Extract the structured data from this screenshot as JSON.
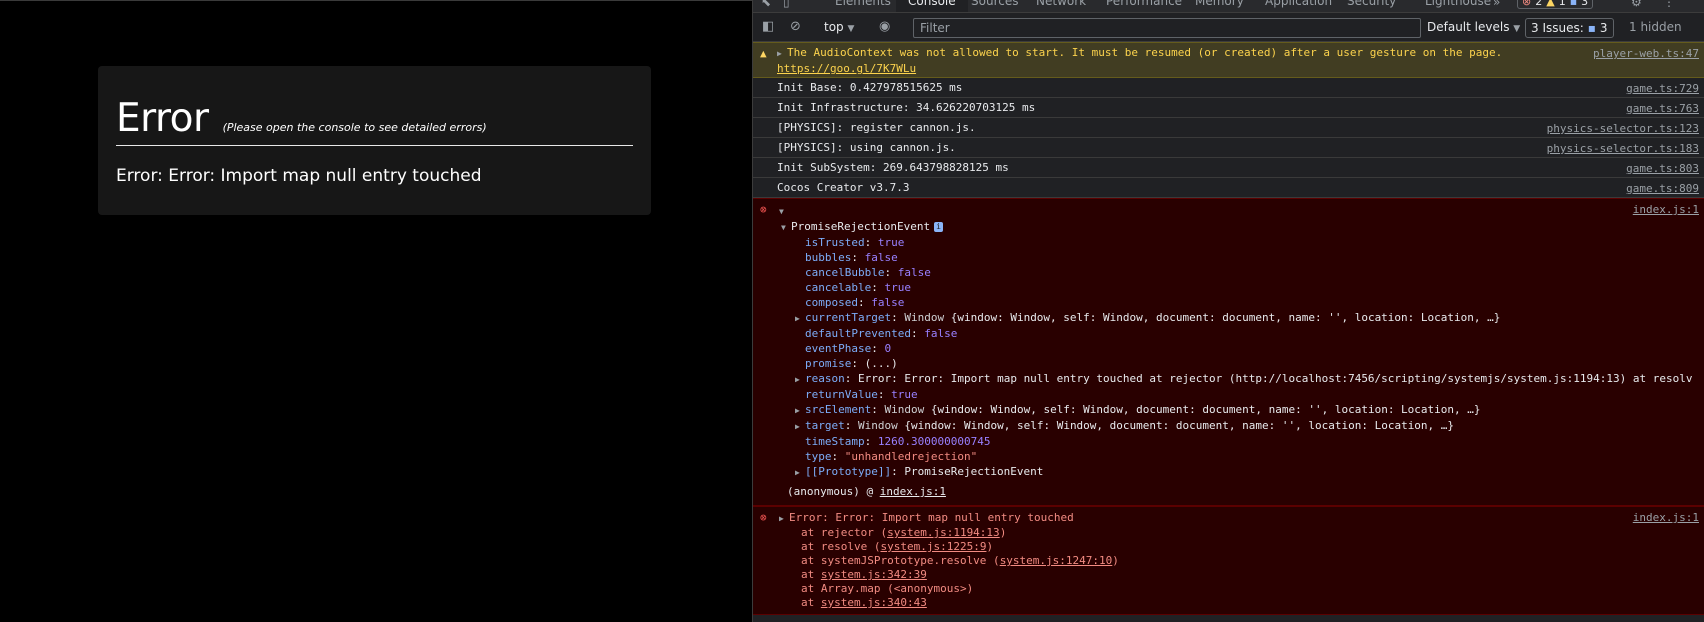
{
  "game": {
    "error_title": "Error",
    "error_hint": "(Please open the console to see detailed errors)",
    "error_message": "Error: Error: Import map null entry touched"
  },
  "devtools": {
    "tabs": [
      "Elements",
      "Console",
      "Sources",
      "Network",
      "Performance",
      "Memory",
      "Application",
      "Security",
      "Lighthouse"
    ],
    "counters": {
      "errors": "2",
      "warnings": "1",
      "info": "3"
    },
    "toolbar": {
      "context": "top",
      "filter_placeholder": "Filter",
      "levels": "Default levels",
      "issues_label": "3 Issues:",
      "issues_count": "3",
      "hidden": "1 hidden"
    },
    "colors": {
      "error_bg": "#290000",
      "warn_bg": "#413d22",
      "accent": "#8ab4f8"
    }
  },
  "console": {
    "warning": {
      "text": "The AudioContext was not allowed to start. It must be resumed (or created) after a user gesture on the page.",
      "link": "https://goo.gl/7K7WLu",
      "source": "player-web.ts:47"
    },
    "logs": [
      {
        "text": "Init Base: 0.427978515625 ms",
        "source": "game.ts:729"
      },
      {
        "text": "Init Infrastructure: 34.626220703125 ms",
        "source": "game.ts:763"
      },
      {
        "text": "[PHYSICS]: register cannon.js.",
        "source": "physics-selector.ts:123"
      },
      {
        "text": "[PHYSICS]: using cannon.js.",
        "source": "physics-selector.ts:183"
      },
      {
        "text": "Init SubSystem: 269.643798828125 ms",
        "source": "game.ts:803"
      },
      {
        "text": "Cocos Creator v3.7.3",
        "source": "game.ts:809"
      }
    ],
    "rejection": {
      "source": "index.js:1",
      "event_name": "PromiseRejectionEvent",
      "badge": "i",
      "props": {
        "isTrusted": "true",
        "bubbles": "false",
        "cancelBubble": "false",
        "cancelable": "true",
        "composed": "false",
        "currentTarget_type": "Window",
        "currentTarget_preview": "{window: Window, self: Window, document: document, name: '', location: Location, …}",
        "defaultPrevented": "false",
        "eventPhase": "0",
        "promise": "(...)",
        "reason": "Error: Error: Import map null entry touched at rejector (http://localhost:7456/scripting/systemjs/system.js:1194:13) at resolv",
        "returnValue": "true",
        "srcElement_type": "Window",
        "srcElement_preview": "{window: Window, self: Window, document: document, name: '', location: Location, …}",
        "target_type": "Window",
        "target_preview": "{window: Window, self: Window, document: document, name: '', location: Location, …}",
        "timeStamp": "1260.300000000745",
        "type": "\"unhandledrejection\"",
        "prototype": "PromiseRejectionEvent"
      },
      "anonymous_label": "(anonymous) @",
      "anonymous_link": "index.js:1"
    },
    "error": {
      "message": "Error: Error: Import map null entry touched",
      "source": "index.js:1",
      "stack": [
        {
          "prefix": "at rejector (",
          "link": "system.js:1194:13",
          "suffix": ")"
        },
        {
          "prefix": "at resolve (",
          "link": "system.js:1225:9",
          "suffix": ")"
        },
        {
          "prefix": "at systemJSPrototype.resolve (",
          "link": "system.js:1247:10",
          "suffix": ")"
        },
        {
          "prefix": "at ",
          "link": "system.js:342:39",
          "suffix": ""
        },
        {
          "prefix": "at Array.map (<anonymous>)",
          "link": "",
          "suffix": ""
        },
        {
          "prefix": "at ",
          "link": "system.js:340:43",
          "suffix": ""
        }
      ]
    }
  }
}
